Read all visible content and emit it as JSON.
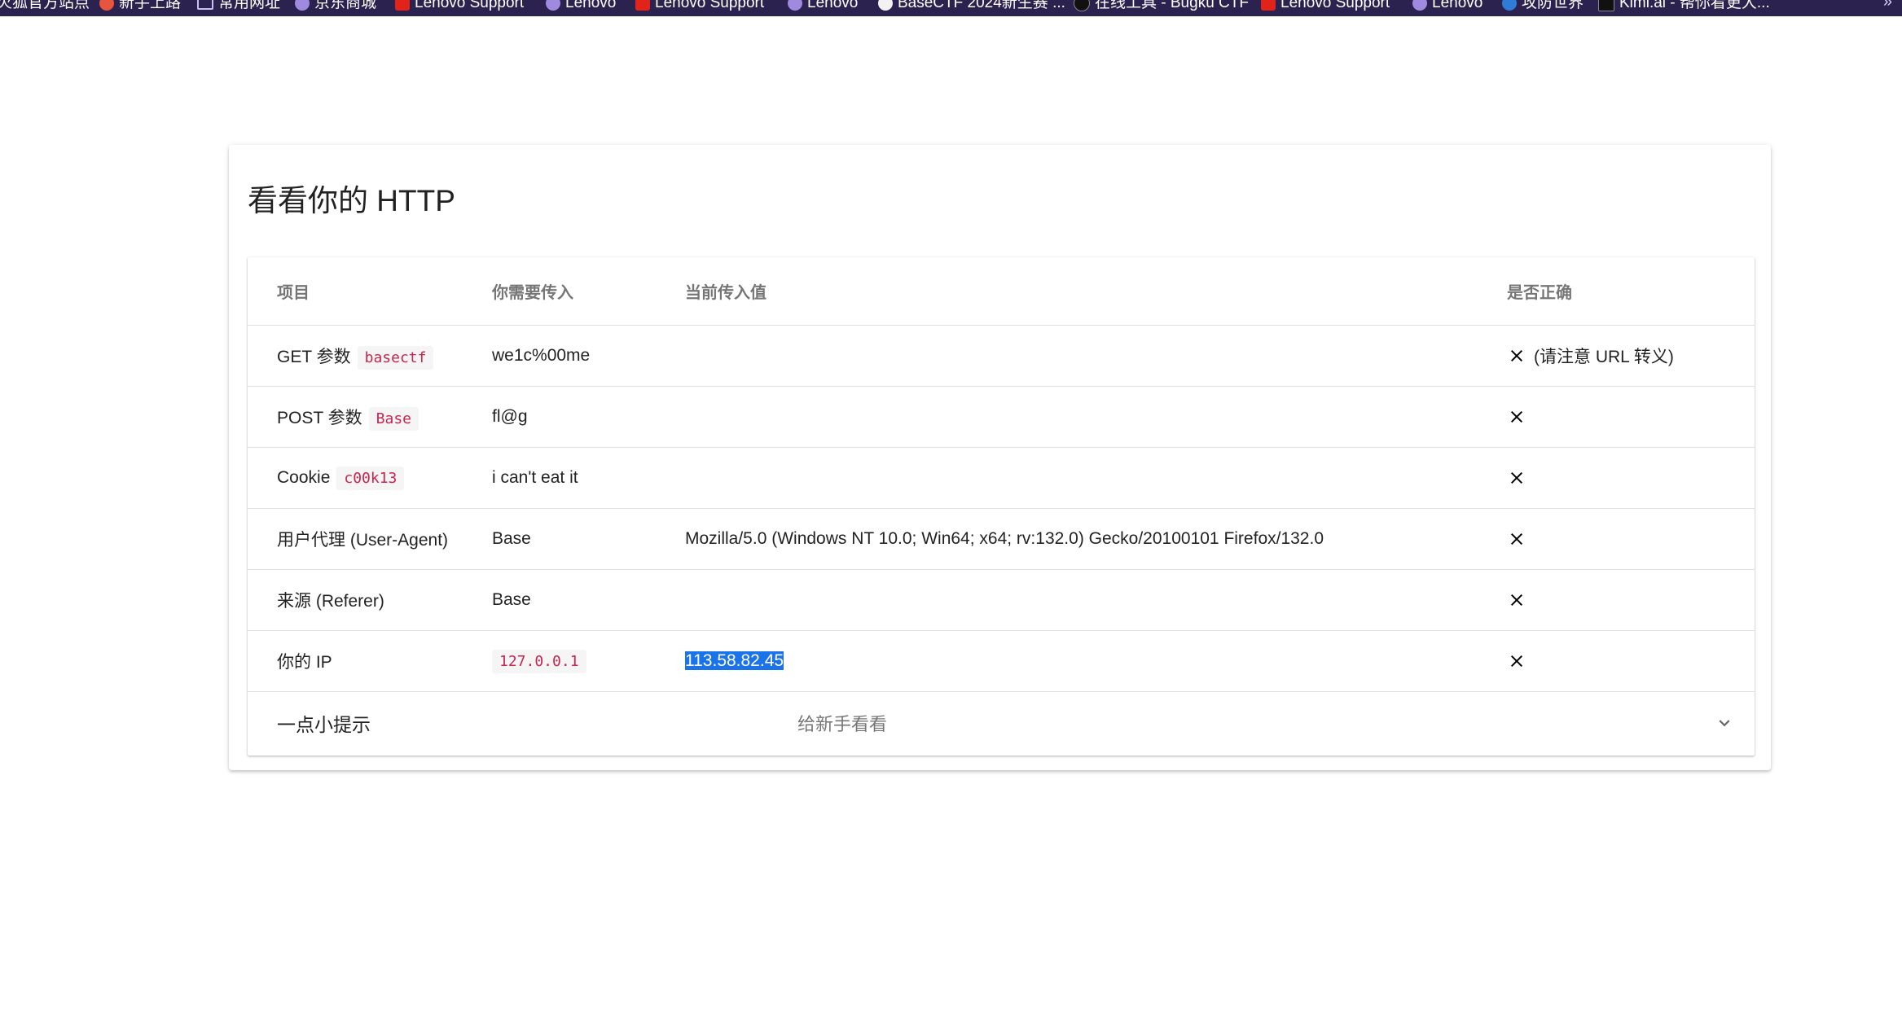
{
  "bookmarks": [
    {
      "label": "火狐官方站点",
      "icon": "firefox-icon"
    },
    {
      "label": "新手上路",
      "icon": "firefox-icon"
    },
    {
      "label": "常用网址",
      "icon": "folder-icon"
    },
    {
      "label": "京东商城",
      "icon": "globe-icon"
    },
    {
      "label": "Lenovo Support",
      "icon": "lenovo-icon"
    },
    {
      "label": "Lenovo",
      "icon": "globe-icon"
    },
    {
      "label": "Lenovo Support",
      "icon": "lenovo-icon"
    },
    {
      "label": "Lenovo",
      "icon": "globe-icon"
    },
    {
      "label": "BaseCTF 2024新生赛 ...",
      "icon": "basectf-icon"
    },
    {
      "label": "在线工具 - Bugku CTF",
      "icon": "bugku-icon"
    },
    {
      "label": "Lenovo Support",
      "icon": "lenovo-icon"
    },
    {
      "label": "Lenovo",
      "icon": "globe-icon"
    },
    {
      "label": "攻防世界",
      "icon": "adworld-icon"
    },
    {
      "label": "Kimi.ai - 帮你看更大...",
      "icon": "kimi-icon"
    }
  ],
  "card": {
    "title": "看看你的 HTTP"
  },
  "table": {
    "headers": {
      "item": "项目",
      "expected": "你需要传入",
      "current": "当前传入值",
      "correct": "是否正确"
    },
    "rows": [
      {
        "label": "GET 参数",
        "key": "basectf",
        "expected": "we1c%00me",
        "current": "",
        "status": "incorrect",
        "note": "(请注意 URL 转义)"
      },
      {
        "label": "POST 参数",
        "key": "Base",
        "expected": "fl@g",
        "current": "",
        "status": "incorrect",
        "note": ""
      },
      {
        "label": "Cookie",
        "key": "c00k13",
        "expected": "i can't eat it",
        "current": "",
        "status": "incorrect",
        "note": ""
      },
      {
        "label": "用户代理 (User-Agent)",
        "key": "",
        "expected": "Base",
        "current": "Mozilla/5.0 (Windows NT 10.0; Win64; x64; rv:132.0) Gecko/20100101 Firefox/132.0",
        "status": "incorrect",
        "note": ""
      },
      {
        "label": "来源 (Referer)",
        "key": "",
        "expected": "Base",
        "current": "",
        "status": "incorrect",
        "note": ""
      },
      {
        "label": "你的 IP",
        "key": "",
        "expected": "127.0.0.1",
        "current": "113.58.82.45",
        "status": "incorrect",
        "note": ""
      }
    ]
  },
  "hint": {
    "title": "一点小提示",
    "subtitle": "给新手看看"
  },
  "colors": {
    "bookmark_bar": "#2b2250",
    "code_text": "#c7254e",
    "selection": "#1a73e8"
  }
}
